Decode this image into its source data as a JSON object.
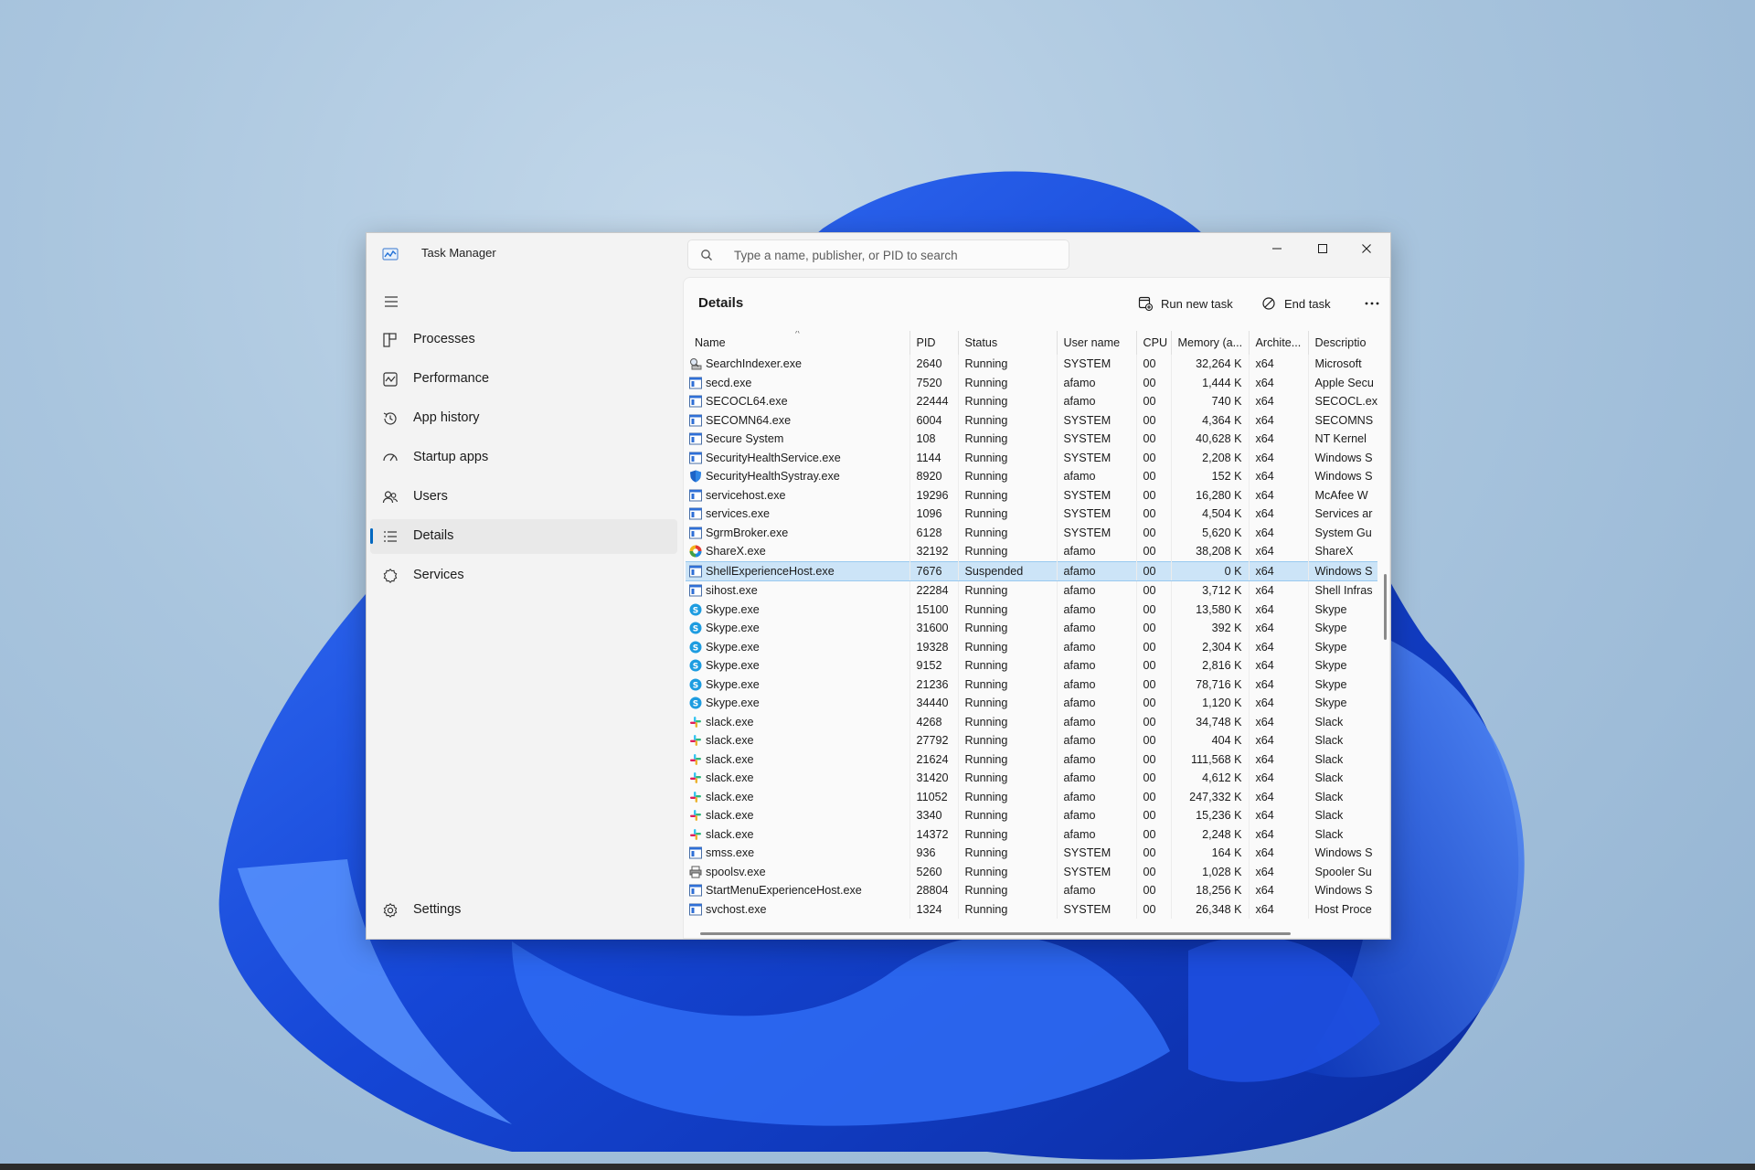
{
  "window": {
    "title": "Task Manager"
  },
  "search": {
    "placeholder": "Type a name, publisher, or PID to search"
  },
  "nav": {
    "items": [
      {
        "label": "Processes",
        "icon": "processes-icon"
      },
      {
        "label": "Performance",
        "icon": "performance-icon"
      },
      {
        "label": "App history",
        "icon": "app-history-icon"
      },
      {
        "label": "Startup apps",
        "icon": "startup-apps-icon"
      },
      {
        "label": "Users",
        "icon": "users-icon"
      },
      {
        "label": "Details",
        "icon": "details-icon",
        "active": true
      },
      {
        "label": "Services",
        "icon": "services-icon"
      }
    ],
    "settings_label": "Settings"
  },
  "page": {
    "title": "Details",
    "run_new_task_label": "Run new task",
    "end_task_label": "End task"
  },
  "table": {
    "columns": [
      "Name",
      "PID",
      "Status",
      "User name",
      "CPU",
      "Memory (a...",
      "Archite...",
      "Descriptio"
    ],
    "rows": [
      {
        "name": "SearchIndexer.exe",
        "pid": "2640",
        "status": "Running",
        "user": "SYSTEM",
        "cpu": "00",
        "memory": "32,264 K",
        "arch": "x64",
        "desc": "Microsoft",
        "icon": "indexer"
      },
      {
        "name": "secd.exe",
        "pid": "7520",
        "status": "Running",
        "user": "afamo",
        "cpu": "00",
        "memory": "1,444 K",
        "arch": "x64",
        "desc": "Apple Secu",
        "icon": "window"
      },
      {
        "name": "SECOCL64.exe",
        "pid": "22444",
        "status": "Running",
        "user": "afamo",
        "cpu": "00",
        "memory": "740 K",
        "arch": "x64",
        "desc": "SECOCL.ex",
        "icon": "window"
      },
      {
        "name": "SECOMN64.exe",
        "pid": "6004",
        "status": "Running",
        "user": "SYSTEM",
        "cpu": "00",
        "memory": "4,364 K",
        "arch": "x64",
        "desc": "SECOMNS",
        "icon": "window"
      },
      {
        "name": "Secure System",
        "pid": "108",
        "status": "Running",
        "user": "SYSTEM",
        "cpu": "00",
        "memory": "40,628 K",
        "arch": "x64",
        "desc": "NT Kernel",
        "icon": "window"
      },
      {
        "name": "SecurityHealthService.exe",
        "pid": "1144",
        "status": "Running",
        "user": "SYSTEM",
        "cpu": "00",
        "memory": "2,208 K",
        "arch": "x64",
        "desc": "Windows S",
        "icon": "window"
      },
      {
        "name": "SecurityHealthSystray.exe",
        "pid": "8920",
        "status": "Running",
        "user": "afamo",
        "cpu": "00",
        "memory": "152 K",
        "arch": "x64",
        "desc": "Windows S",
        "icon": "shield"
      },
      {
        "name": "servicehost.exe",
        "pid": "19296",
        "status": "Running",
        "user": "SYSTEM",
        "cpu": "00",
        "memory": "16,280 K",
        "arch": "x64",
        "desc": "McAfee W",
        "icon": "window"
      },
      {
        "name": "services.exe",
        "pid": "1096",
        "status": "Running",
        "user": "SYSTEM",
        "cpu": "00",
        "memory": "4,504 K",
        "arch": "x64",
        "desc": "Services ar",
        "icon": "window"
      },
      {
        "name": "SgrmBroker.exe",
        "pid": "6128",
        "status": "Running",
        "user": "SYSTEM",
        "cpu": "00",
        "memory": "5,620 K",
        "arch": "x64",
        "desc": "System Gu",
        "icon": "window"
      },
      {
        "name": "ShareX.exe",
        "pid": "32192",
        "status": "Running",
        "user": "afamo",
        "cpu": "00",
        "memory": "38,208 K",
        "arch": "x64",
        "desc": "ShareX",
        "icon": "sharex"
      },
      {
        "name": "ShellExperienceHost.exe",
        "pid": "7676",
        "status": "Suspended",
        "user": "afamo",
        "cpu": "00",
        "memory": "0 K",
        "arch": "x64",
        "desc": "Windows S",
        "icon": "window",
        "selected": true
      },
      {
        "name": "sihost.exe",
        "pid": "22284",
        "status": "Running",
        "user": "afamo",
        "cpu": "00",
        "memory": "3,712 K",
        "arch": "x64",
        "desc": "Shell Infras",
        "icon": "window"
      },
      {
        "name": "Skype.exe",
        "pid": "15100",
        "status": "Running",
        "user": "afamo",
        "cpu": "00",
        "memory": "13,580 K",
        "arch": "x64",
        "desc": "Skype",
        "icon": "skype"
      },
      {
        "name": "Skype.exe",
        "pid": "31600",
        "status": "Running",
        "user": "afamo",
        "cpu": "00",
        "memory": "392 K",
        "arch": "x64",
        "desc": "Skype",
        "icon": "skype"
      },
      {
        "name": "Skype.exe",
        "pid": "19328",
        "status": "Running",
        "user": "afamo",
        "cpu": "00",
        "memory": "2,304 K",
        "arch": "x64",
        "desc": "Skype",
        "icon": "skype"
      },
      {
        "name": "Skype.exe",
        "pid": "9152",
        "status": "Running",
        "user": "afamo",
        "cpu": "00",
        "memory": "2,816 K",
        "arch": "x64",
        "desc": "Skype",
        "icon": "skype"
      },
      {
        "name": "Skype.exe",
        "pid": "21236",
        "status": "Running",
        "user": "afamo",
        "cpu": "00",
        "memory": "78,716 K",
        "arch": "x64",
        "desc": "Skype",
        "icon": "skype"
      },
      {
        "name": "Skype.exe",
        "pid": "34440",
        "status": "Running",
        "user": "afamo",
        "cpu": "00",
        "memory": "1,120 K",
        "arch": "x64",
        "desc": "Skype",
        "icon": "skype"
      },
      {
        "name": "slack.exe",
        "pid": "4268",
        "status": "Running",
        "user": "afamo",
        "cpu": "00",
        "memory": "34,748 K",
        "arch": "x64",
        "desc": "Slack",
        "icon": "slack"
      },
      {
        "name": "slack.exe",
        "pid": "27792",
        "status": "Running",
        "user": "afamo",
        "cpu": "00",
        "memory": "404 K",
        "arch": "x64",
        "desc": "Slack",
        "icon": "slack"
      },
      {
        "name": "slack.exe",
        "pid": "21624",
        "status": "Running",
        "user": "afamo",
        "cpu": "00",
        "memory": "111,568 K",
        "arch": "x64",
        "desc": "Slack",
        "icon": "slack"
      },
      {
        "name": "slack.exe",
        "pid": "31420",
        "status": "Running",
        "user": "afamo",
        "cpu": "00",
        "memory": "4,612 K",
        "arch": "x64",
        "desc": "Slack",
        "icon": "slack"
      },
      {
        "name": "slack.exe",
        "pid": "11052",
        "status": "Running",
        "user": "afamo",
        "cpu": "00",
        "memory": "247,332 K",
        "arch": "x64",
        "desc": "Slack",
        "icon": "slack"
      },
      {
        "name": "slack.exe",
        "pid": "3340",
        "status": "Running",
        "user": "afamo",
        "cpu": "00",
        "memory": "15,236 K",
        "arch": "x64",
        "desc": "Slack",
        "icon": "slack"
      },
      {
        "name": "slack.exe",
        "pid": "14372",
        "status": "Running",
        "user": "afamo",
        "cpu": "00",
        "memory": "2,248 K",
        "arch": "x64",
        "desc": "Slack",
        "icon": "slack"
      },
      {
        "name": "smss.exe",
        "pid": "936",
        "status": "Running",
        "user": "SYSTEM",
        "cpu": "00",
        "memory": "164 K",
        "arch": "x64",
        "desc": "Windows S",
        "icon": "window"
      },
      {
        "name": "spoolsv.exe",
        "pid": "5260",
        "status": "Running",
        "user": "SYSTEM",
        "cpu": "00",
        "memory": "1,028 K",
        "arch": "x64",
        "desc": "Spooler Su",
        "icon": "printer"
      },
      {
        "name": "StartMenuExperienceHost.exe",
        "pid": "28804",
        "status": "Running",
        "user": "afamo",
        "cpu": "00",
        "memory": "18,256 K",
        "arch": "x64",
        "desc": "Windows S",
        "icon": "window"
      },
      {
        "name": "svchost.exe",
        "pid": "1324",
        "status": "Running",
        "user": "SYSTEM",
        "cpu": "00",
        "memory": "26,348 K",
        "arch": "x64",
        "desc": "Host Proce",
        "icon": "window"
      }
    ]
  },
  "colors": {
    "accent": "#0067c0",
    "selected_row": "#cce4f7"
  }
}
